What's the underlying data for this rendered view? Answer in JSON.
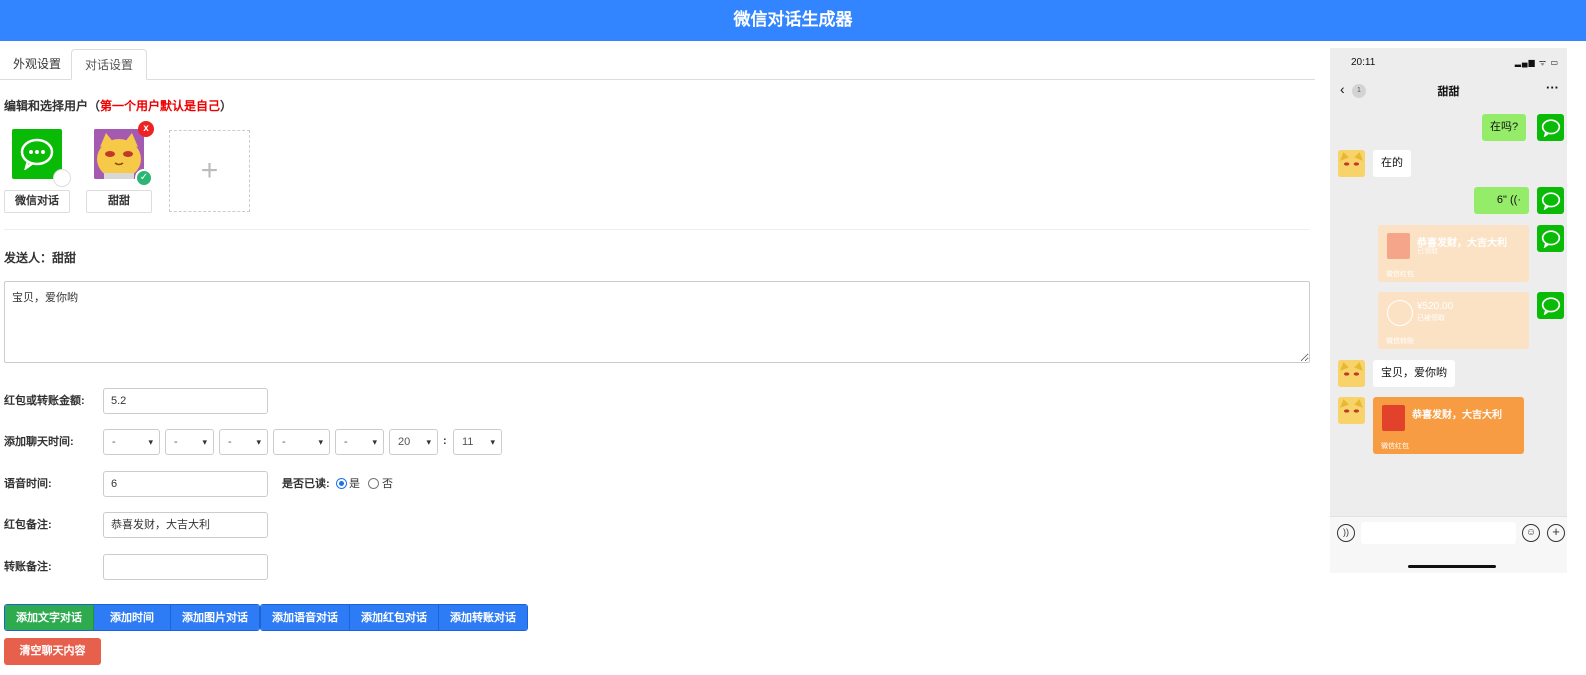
{
  "header": {
    "title": "微信对话生成器"
  },
  "tabs": [
    {
      "label": "外观设置"
    },
    {
      "label": "对话设置"
    }
  ],
  "users_section": {
    "title_prefix": "编辑和选择用户（",
    "title_red": "第一个用户默认是自己",
    "title_suffix": "）"
  },
  "users": [
    {
      "name": "微信对话"
    },
    {
      "name": "甜甜"
    }
  ],
  "add_user": {
    "label": "+"
  },
  "remove_badge": "x",
  "check_badge": "✓",
  "sender": {
    "text": "发送人：甜甜"
  },
  "message": {
    "value": "宝贝，爱你哟"
  },
  "form": {
    "amount_label": "红包或转账金额:",
    "amount_value": "5.2",
    "time_label": "添加聊天时间:",
    "time_selects": [
      "-",
      "-",
      "-",
      "-",
      "-",
      "20",
      "11"
    ],
    "time_colon": ":",
    "voice_label": "语音时间:",
    "voice_value": "6",
    "read_label": "是否已读:",
    "read_yes": "是",
    "read_no": "否",
    "redpacket_note_label": "红包备注:",
    "redpacket_note_value": "恭喜发财，大吉大利",
    "transfer_note_label": "转账备注:",
    "transfer_note_value": ""
  },
  "buttons": {
    "add_text": "添加文字对话",
    "add_time": "添加时间",
    "add_image": "添加图片对话",
    "add_voice": "添加语音对话",
    "add_redpacket": "添加红包对话",
    "add_transfer": "添加转账对话",
    "clear": "清空聊天内容"
  },
  "phone": {
    "time": "20:11",
    "status_icons": "▂▄▆ ᯤ ▭",
    "back": "‹",
    "unread": "1",
    "title": "甜甜",
    "more": "···",
    "messages": {
      "m1": "在吗?",
      "m2": "在的",
      "m3": "6\" ((·",
      "rp1_title": "恭喜发财，大吉大利",
      "rp1_status": "已领取",
      "rp1_foot": "微信红包",
      "tr_amount": "¥520.00",
      "tr_status": "已被领取",
      "tr_foot": "微信转账",
      "m6": "宝贝，爱你哟",
      "rp2_title": "恭喜发财，大吉大利",
      "rp2_foot": "微信红包"
    },
    "voice_icon": "))",
    "emoji_icon": "☺",
    "plus_icon": "+"
  },
  "colors": {
    "header": "#3385ff",
    "green_button": "#2eaa4f",
    "blue_button": "#2d7cf5",
    "clear_button": "#e6604c",
    "wechat_green": "#09bb07",
    "bubble_green": "#95ec69",
    "redpacket": "#f79c42"
  }
}
